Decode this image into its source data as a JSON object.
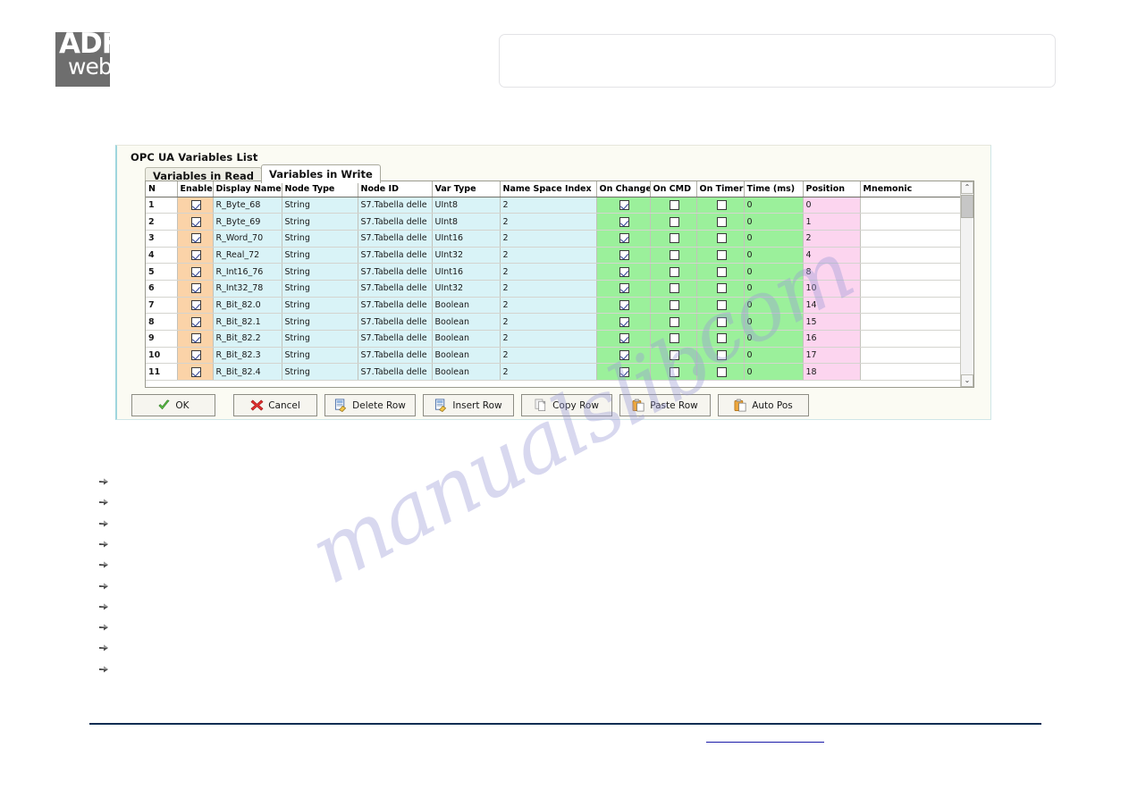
{
  "logo": {
    "line1": "ADF",
    "line2": "web",
    "alt": "ADFweb logo"
  },
  "header_box": {
    "content": ""
  },
  "dialog": {
    "title": "OPC UA Variables List",
    "tabs": [
      {
        "label": "Variables in Read",
        "active": false
      },
      {
        "label": "Variables in Write",
        "active": true
      }
    ],
    "columns": [
      "N",
      "Enable",
      "Display Name",
      "Node Type",
      "Node ID",
      "Var Type",
      "Name Space Index",
      "On Change",
      "On CMD",
      "On Timer",
      "Time (ms)",
      "Position",
      "Mnemonic"
    ],
    "rows": [
      {
        "n": "1",
        "enable": true,
        "display_name": "R_Byte_68",
        "node_type": "String",
        "node_id": "S7.Tabella delle",
        "var_type": "UInt8",
        "name_space_index": "2",
        "on_change": true,
        "on_cmd": false,
        "on_timer": false,
        "time_ms": "0",
        "position": "0",
        "mnemonic": ""
      },
      {
        "n": "2",
        "enable": true,
        "display_name": "R_Byte_69",
        "node_type": "String",
        "node_id": "S7.Tabella delle",
        "var_type": "UInt8",
        "name_space_index": "2",
        "on_change": true,
        "on_cmd": false,
        "on_timer": false,
        "time_ms": "0",
        "position": "1",
        "mnemonic": ""
      },
      {
        "n": "3",
        "enable": true,
        "display_name": "R_Word_70",
        "node_type": "String",
        "node_id": "S7.Tabella delle",
        "var_type": "UInt16",
        "name_space_index": "2",
        "on_change": true,
        "on_cmd": false,
        "on_timer": false,
        "time_ms": "0",
        "position": "2",
        "mnemonic": ""
      },
      {
        "n": "4",
        "enable": true,
        "display_name": "R_Real_72",
        "node_type": "String",
        "node_id": "S7.Tabella delle",
        "var_type": "UInt32",
        "name_space_index": "2",
        "on_change": true,
        "on_cmd": false,
        "on_timer": false,
        "time_ms": "0",
        "position": "4",
        "mnemonic": ""
      },
      {
        "n": "5",
        "enable": true,
        "display_name": "R_Int16_76",
        "node_type": "String",
        "node_id": "S7.Tabella delle",
        "var_type": "UInt16",
        "name_space_index": "2",
        "on_change": true,
        "on_cmd": false,
        "on_timer": false,
        "time_ms": "0",
        "position": "8",
        "mnemonic": ""
      },
      {
        "n": "6",
        "enable": true,
        "display_name": "R_Int32_78",
        "node_type": "String",
        "node_id": "S7.Tabella delle",
        "var_type": "UInt32",
        "name_space_index": "2",
        "on_change": true,
        "on_cmd": false,
        "on_timer": false,
        "time_ms": "0",
        "position": "10",
        "mnemonic": ""
      },
      {
        "n": "7",
        "enable": true,
        "display_name": "R_Bit_82.0",
        "node_type": "String",
        "node_id": "S7.Tabella delle",
        "var_type": "Boolean",
        "name_space_index": "2",
        "on_change": true,
        "on_cmd": false,
        "on_timer": false,
        "time_ms": "0",
        "position": "14",
        "mnemonic": ""
      },
      {
        "n": "8",
        "enable": true,
        "display_name": "R_Bit_82.1",
        "node_type": "String",
        "node_id": "S7.Tabella delle",
        "var_type": "Boolean",
        "name_space_index": "2",
        "on_change": true,
        "on_cmd": false,
        "on_timer": false,
        "time_ms": "0",
        "position": "15",
        "mnemonic": ""
      },
      {
        "n": "9",
        "enable": true,
        "display_name": "R_Bit_82.2",
        "node_type": "String",
        "node_id": "S7.Tabella delle",
        "var_type": "Boolean",
        "name_space_index": "2",
        "on_change": true,
        "on_cmd": false,
        "on_timer": false,
        "time_ms": "0",
        "position": "16",
        "mnemonic": ""
      },
      {
        "n": "10",
        "enable": true,
        "display_name": "R_Bit_82.3",
        "node_type": "String",
        "node_id": "S7.Tabella delle",
        "var_type": "Boolean",
        "name_space_index": "2",
        "on_change": true,
        "on_cmd": false,
        "on_timer": false,
        "time_ms": "0",
        "position": "17",
        "mnemonic": ""
      },
      {
        "n": "11",
        "enable": true,
        "display_name": "R_Bit_82.4",
        "node_type": "String",
        "node_id": "S7.Tabella delle",
        "var_type": "Boolean",
        "name_space_index": "2",
        "on_change": true,
        "on_cmd": false,
        "on_timer": false,
        "time_ms": "0",
        "position": "18",
        "mnemonic": ""
      }
    ],
    "buttons": [
      {
        "label": "OK",
        "icon": "green-check-icon"
      },
      {
        "label": "Cancel",
        "icon": "red-cross-icon"
      },
      {
        "label": "Delete Row",
        "icon": "delete-row-icon"
      },
      {
        "label": "Insert Row",
        "icon": "insert-row-icon"
      },
      {
        "label": "Copy Row",
        "icon": "copy-row-icon"
      },
      {
        "label": "Paste Row",
        "icon": "paste-row-icon"
      },
      {
        "label": "Auto Pos",
        "icon": "auto-pos-icon"
      }
    ],
    "scrollbar": {
      "up_arrow": "⌃",
      "down_arrow": "⌄"
    }
  },
  "bullet_list": {
    "count": 10,
    "items": [
      "",
      "",
      "",
      "",
      "",
      "",
      "",
      "",
      "",
      ""
    ]
  },
  "watermark": {
    "line1": "manualslib",
    "line2": ".com"
  },
  "colors": {
    "enable_column": "#fbd3a8",
    "data_column": "#d9f3f7",
    "trigger_column": "#9bf09b",
    "position_column": "#fcd5ef",
    "dialog_background": "#fbfbf3",
    "footer_rule": "#0b2d52",
    "link": "#1a1aa8",
    "logo_background": "#6e6e6e"
  }
}
